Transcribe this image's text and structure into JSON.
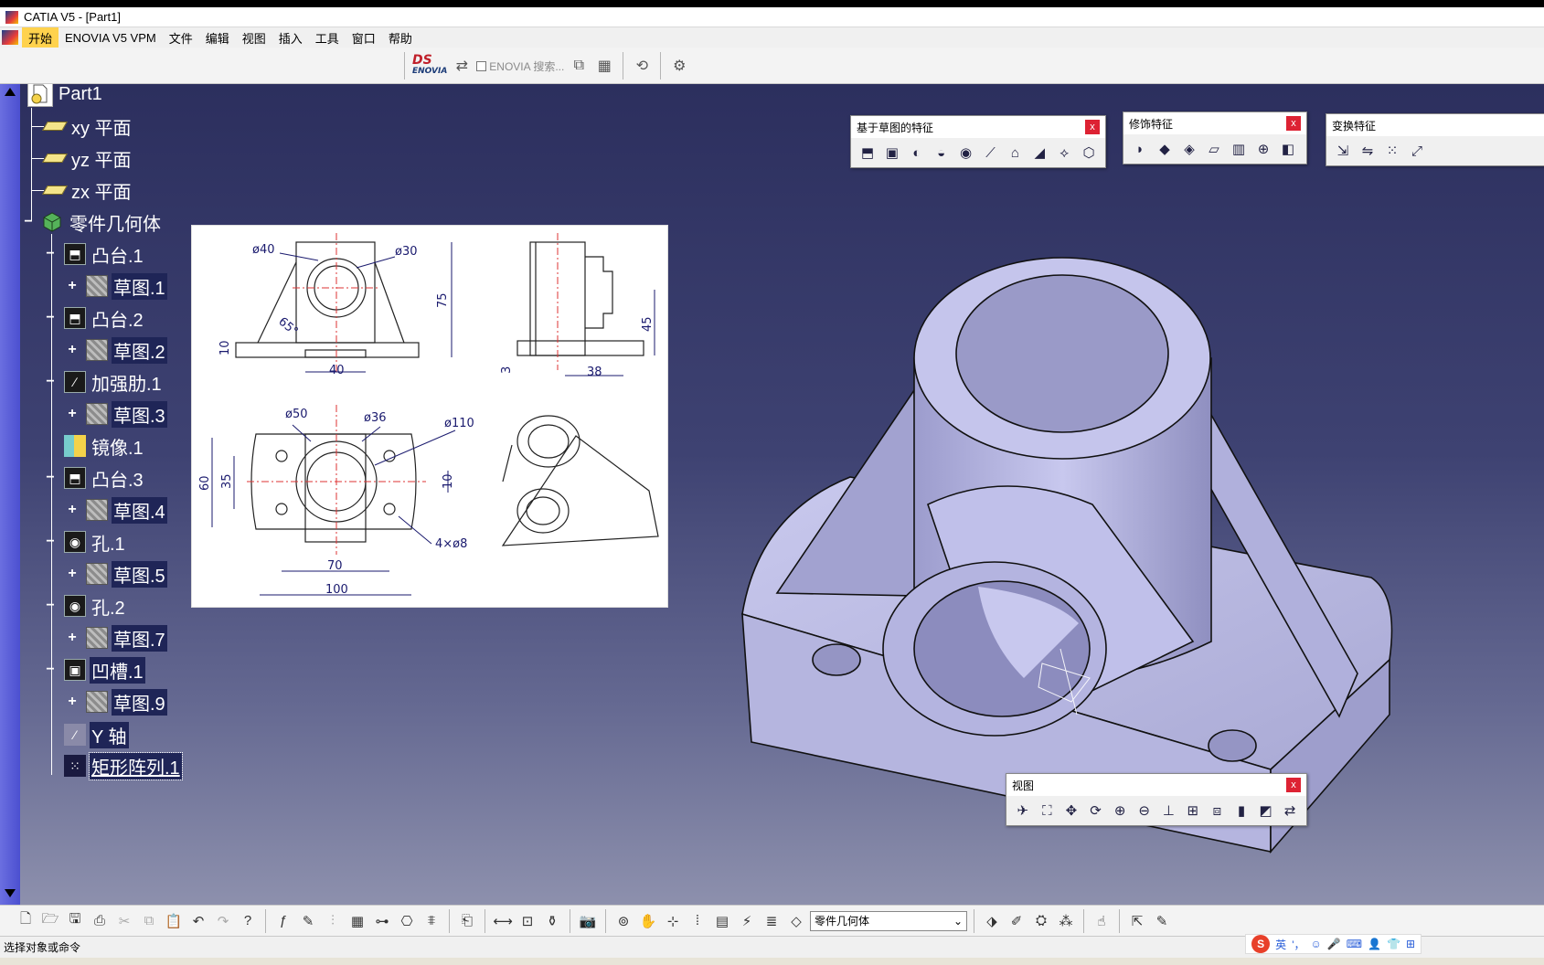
{
  "window": {
    "title": "CATIA V5 - [Part1]"
  },
  "menu": [
    "开始",
    "ENOVIA V5 VPM",
    "文件",
    "编辑",
    "视图",
    "插入",
    "工具",
    "窗口",
    "帮助"
  ],
  "top_toolbar": {
    "ds_logo": "ENOVIA",
    "search_label": "ENOVIA 搜索..."
  },
  "tree": {
    "root": "Part1",
    "planes": [
      "xy 平面",
      "yz 平面",
      "zx 平面"
    ],
    "body": "零件几何体",
    "features": [
      {
        "name": "凸台.1",
        "sketch": "草图.1",
        "icon": "pad-icon"
      },
      {
        "name": "凸台.2",
        "sketch": "草图.2",
        "icon": "pad-icon"
      },
      {
        "name": "加强肋.1",
        "sketch": "草图.3",
        "icon": "rib-icon"
      },
      {
        "name": "镜像.1",
        "sketch": null,
        "icon": "mirror-icon"
      },
      {
        "name": "凸台.3",
        "sketch": "草图.4",
        "icon": "pad-icon"
      },
      {
        "name": "孔.1",
        "sketch": "草图.5",
        "icon": "hole-icon"
      },
      {
        "name": "孔.2",
        "sketch": "草图.7",
        "icon": "hole-icon"
      },
      {
        "name": "凹槽.1",
        "sketch": "草图.9",
        "icon": "pocket-icon"
      }
    ],
    "axis": "Y 轴",
    "pattern": "矩形阵列.1"
  },
  "drawing": {
    "dims": {
      "d40": "ø40",
      "d30": "ø30",
      "h75": "75",
      "ang": "65°",
      "h10": "10",
      "w40": "40",
      "h45": "45",
      "w38": "38",
      "v3": "3",
      "d50": "ø50",
      "d36": "ø36",
      "d110": "ø110",
      "h60": "60",
      "h35": "35",
      "r10": "10",
      "w70": "70",
      "w100": "100",
      "holes": "4×ø8"
    }
  },
  "floating_toolbars": {
    "sketch_features": {
      "title": "基于草图的特征",
      "close": "x"
    },
    "dress_up": {
      "title": "修饰特征",
      "close": "x"
    },
    "transform": {
      "title": "变换特征"
    },
    "view": {
      "title": "视图",
      "close": "x"
    }
  },
  "bottom_toolbar": {
    "body_select": "零件几何体"
  },
  "status": {
    "message": "选择对象或命令"
  },
  "ime": {
    "mode": "英"
  }
}
